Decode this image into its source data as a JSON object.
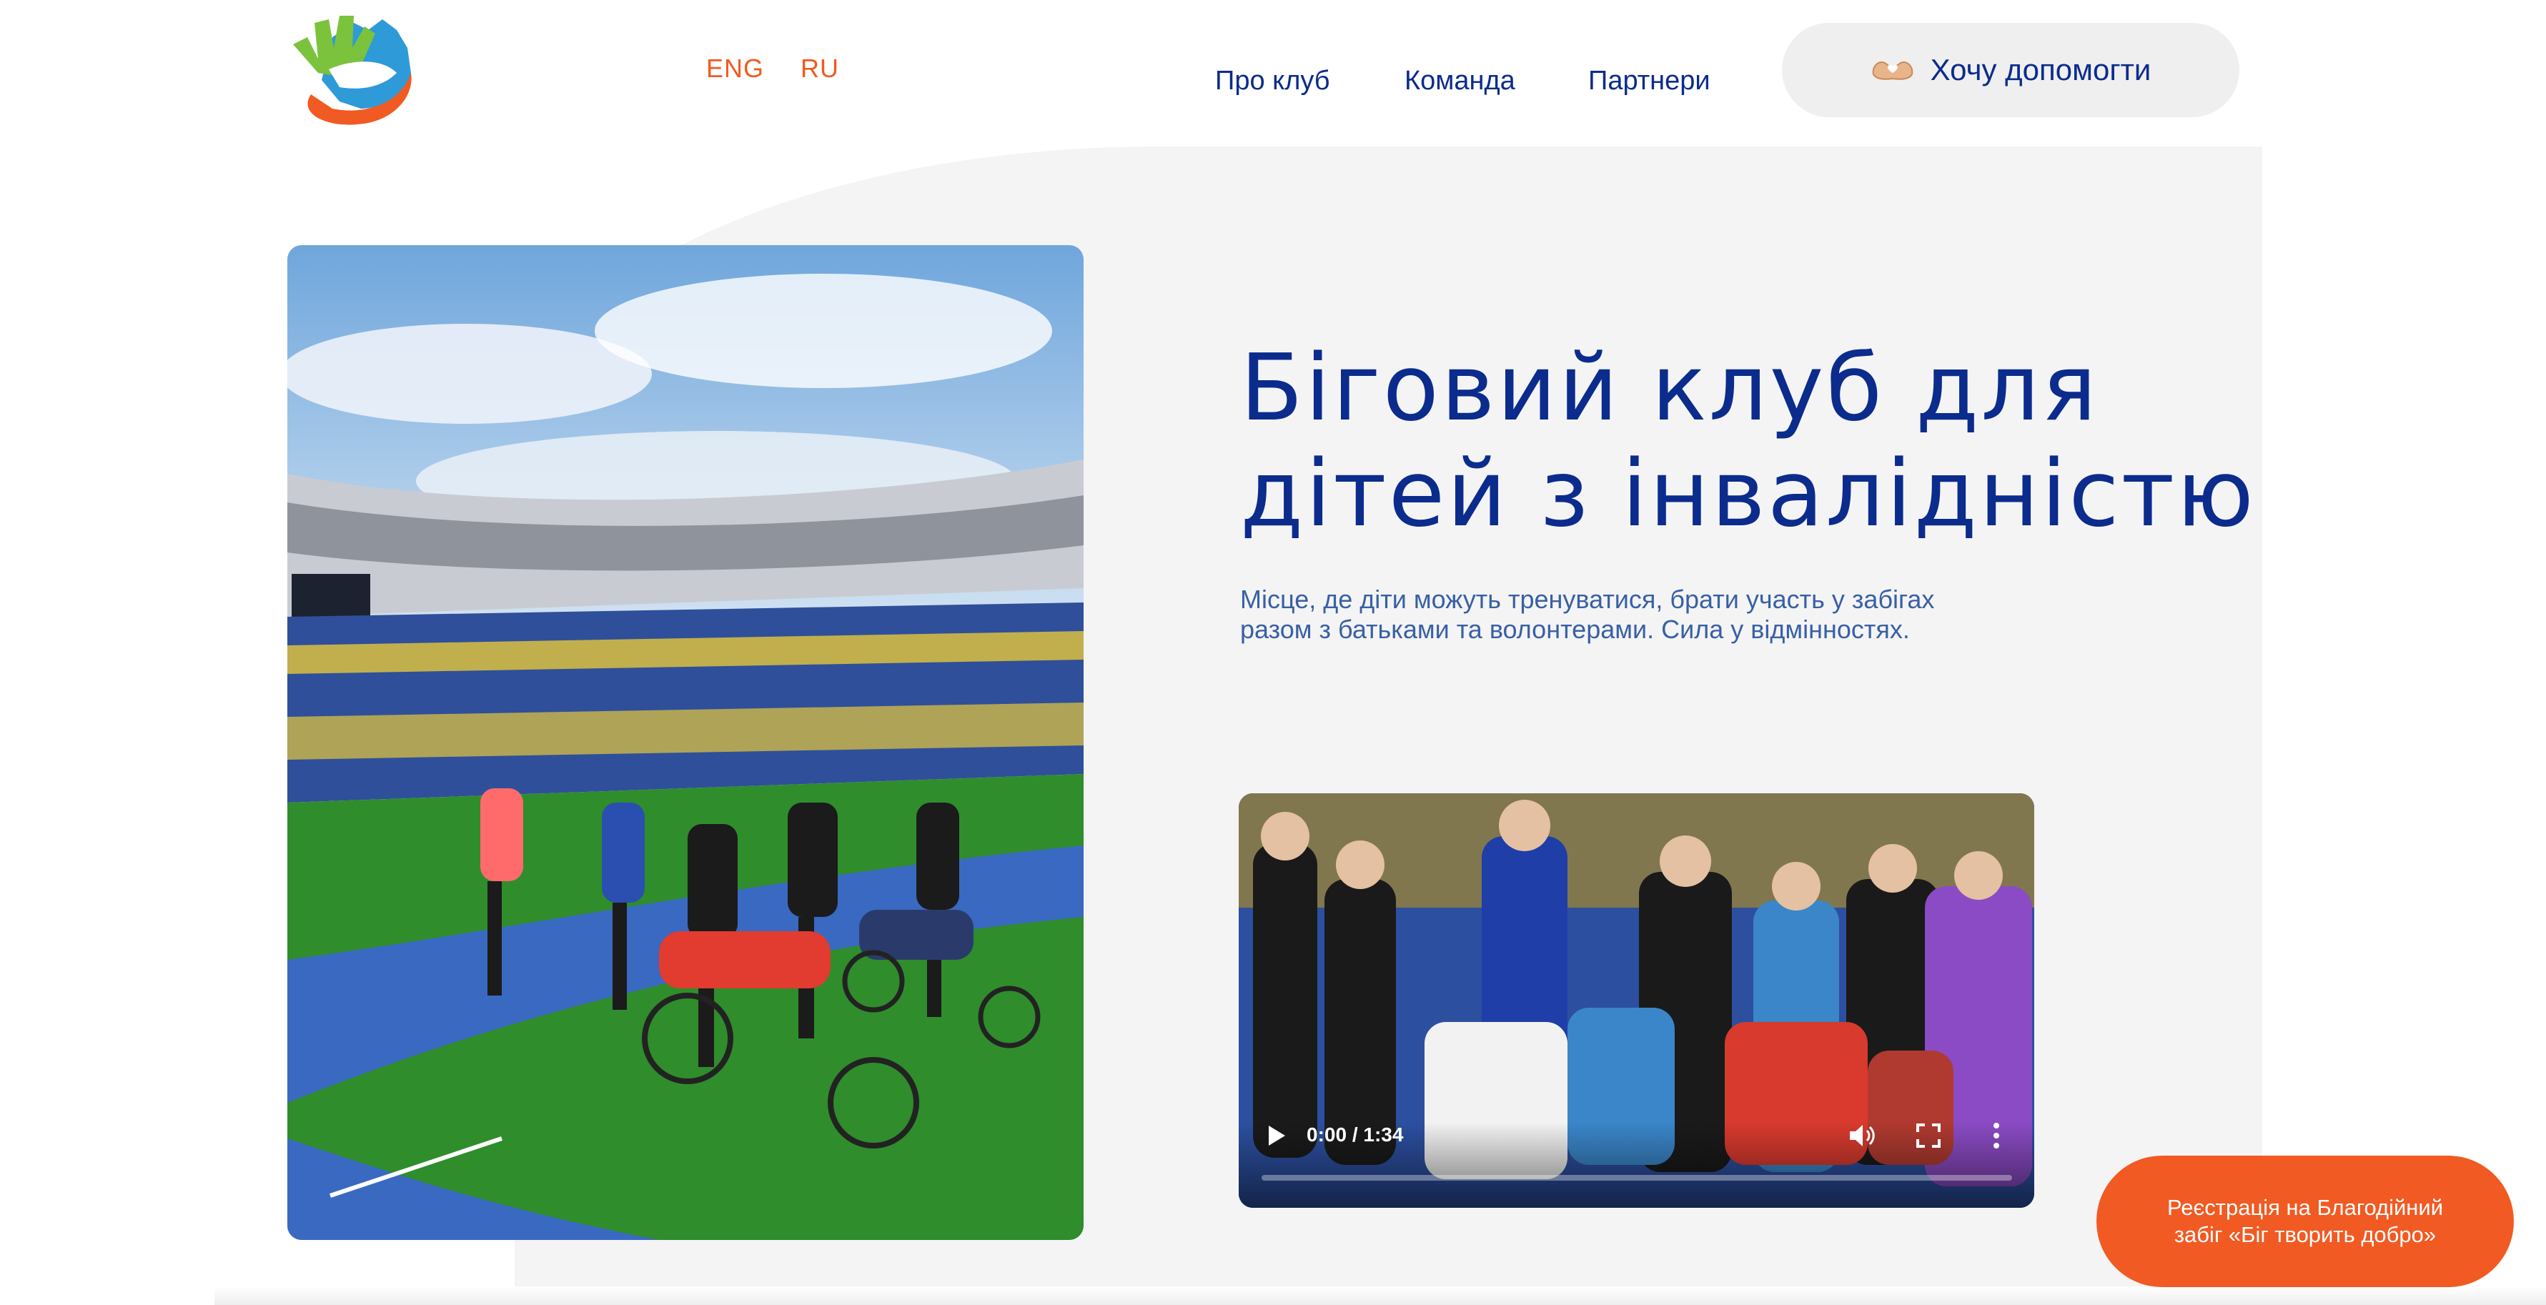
{
  "header": {
    "languages": [
      "ENG",
      "RU"
    ],
    "nav": [
      "Про клуб",
      "Команда",
      "Партнери"
    ],
    "help_button": "Хочу допомогти",
    "icons": {
      "logo": "hand-logo-icon",
      "help": "heart-hands-icon"
    }
  },
  "hero": {
    "title_line1": "Біговий клуб для",
    "title_line2": "дітей з інвалідністю",
    "subtitle": "Місце, де діти можуть тренуватися, брати участь у забігах разом з батьками та волонтерами. Сила у відмінностях."
  },
  "video": {
    "time": "0:00 / 1:34",
    "progress": 0,
    "icons": [
      "play-icon",
      "volume-icon",
      "fullscreen-icon",
      "more-vert-icon"
    ]
  },
  "registration": {
    "line1": "Реєстрація на Благодійний",
    "line2": "забіг «Біг творить добро»"
  },
  "colors": {
    "brand_blue": "#0b2c8c",
    "accent_orange": "#f15a22",
    "subtitle_blue": "#3960a4",
    "panel_gray": "#f4f4f5"
  }
}
